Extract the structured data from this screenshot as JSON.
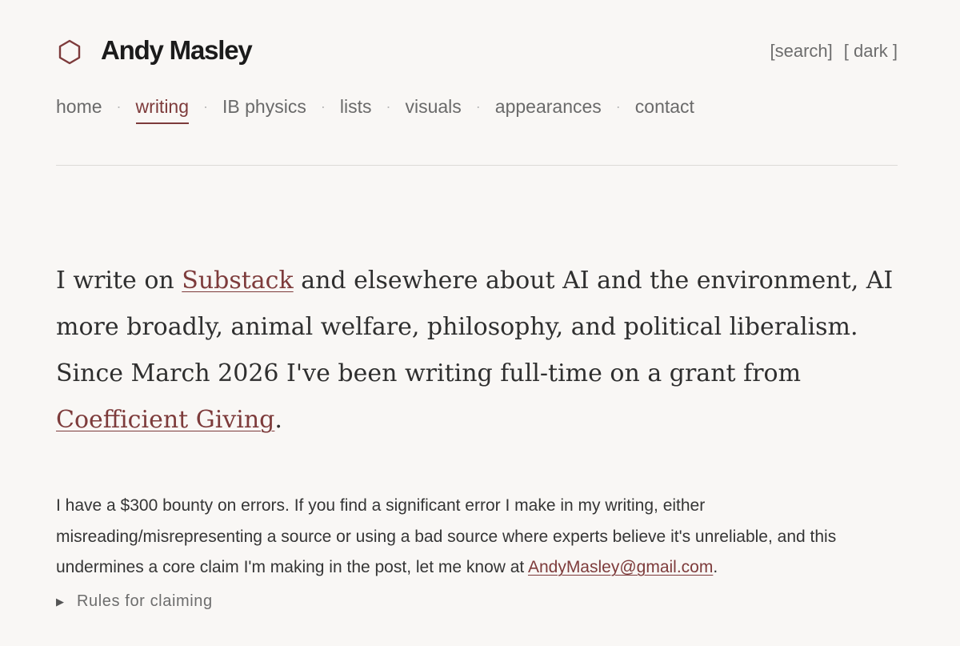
{
  "header": {
    "logo_icon": "hexagon-icon",
    "title": "Andy Masley",
    "controls": {
      "search_label": "[search]",
      "dark_label": "[ dark ]"
    }
  },
  "nav": {
    "items": [
      {
        "label": "home",
        "active": false
      },
      {
        "label": "writing",
        "active": true
      },
      {
        "label": "IB physics",
        "active": false
      },
      {
        "label": "lists",
        "active": false
      },
      {
        "label": "visuals",
        "active": false
      },
      {
        "label": "appearances",
        "active": false
      },
      {
        "label": "contact",
        "active": false
      }
    ],
    "separator": "·"
  },
  "intro": {
    "text_before_link": "I write on ",
    "substack_link": "Substack",
    "text_middle": " and elsewhere about AI and the environment, AI more broadly, animal welfare, philosophy, and political liberalism. Since March 2026 I've been writing full-time on a grant from ",
    "grant_link": "Coefficient Giving",
    "text_end": "."
  },
  "bounty": {
    "text": "I have a $300 bounty on errors. If you find a significant error I make in my writing, either misreading/misrepresenting a source or using a bad source where experts believe it's unreliable, and this undermines a core claim I'm making in the post, let me know at ",
    "email": "AndyMasley@gmail.com",
    "text_end": "."
  },
  "rules_toggle": {
    "icon": "triangle-right-icon",
    "label": "Rules for claiming"
  },
  "colors": {
    "accent": "#7d3b3b",
    "background": "#f9f7f5",
    "text": "#2b2b2b",
    "muted": "#6a6a6a"
  }
}
